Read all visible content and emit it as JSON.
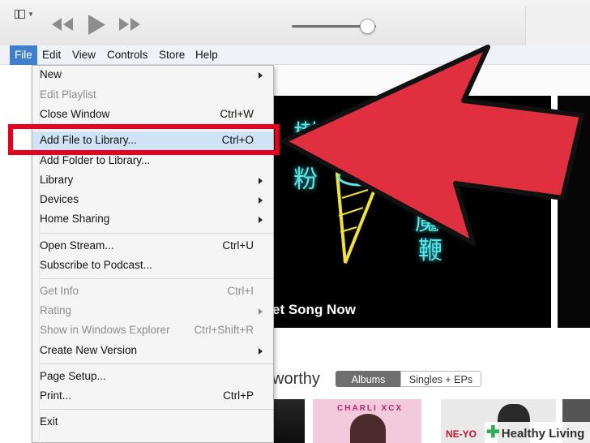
{
  "menubar": {
    "items": [
      {
        "label": "File"
      },
      {
        "label": "Edit"
      },
      {
        "label": "View"
      },
      {
        "label": "Controls"
      },
      {
        "label": "Store"
      },
      {
        "label": "Help"
      }
    ]
  },
  "player": {
    "volume_level": 0.9
  },
  "file_menu": {
    "items": [
      {
        "label": "New",
        "shortcut": "",
        "submenu": true,
        "enabled": true
      },
      {
        "label": "Edit Playlist",
        "shortcut": "",
        "submenu": false,
        "enabled": false
      },
      {
        "label": "Close Window",
        "shortcut": "Ctrl+W",
        "submenu": false,
        "enabled": true
      },
      {
        "label": "Add File to Library...",
        "shortcut": "Ctrl+O",
        "submenu": false,
        "enabled": true,
        "highlighted": true
      },
      {
        "label": "Add Folder to Library...",
        "shortcut": "",
        "submenu": false,
        "enabled": true
      },
      {
        "label": "Library",
        "shortcut": "",
        "submenu": true,
        "enabled": true
      },
      {
        "label": "Devices",
        "shortcut": "",
        "submenu": true,
        "enabled": true
      },
      {
        "label": "Home Sharing",
        "shortcut": "",
        "submenu": true,
        "enabled": true
      },
      {
        "label": "Open Stream...",
        "shortcut": "Ctrl+U",
        "submenu": false,
        "enabled": true
      },
      {
        "label": "Subscribe to Podcast...",
        "shortcut": "",
        "submenu": false,
        "enabled": true
      },
      {
        "label": "Get Info",
        "shortcut": "Ctrl+I",
        "submenu": false,
        "enabled": false
      },
      {
        "label": "Rating",
        "shortcut": "",
        "submenu": true,
        "enabled": false
      },
      {
        "label": "Show in Windows Explorer",
        "shortcut": "Ctrl+Shift+R",
        "submenu": false,
        "enabled": false
      },
      {
        "label": "Create New Version",
        "shortcut": "",
        "submenu": true,
        "enabled": true
      },
      {
        "label": "Page Setup...",
        "shortcut": "",
        "submenu": false,
        "enabled": true
      },
      {
        "label": "Print...",
        "shortcut": "Ctrl+P",
        "submenu": false,
        "enabled": true
      },
      {
        "label": "Exit",
        "shortcut": "",
        "submenu": false,
        "enabled": true
      }
    ]
  },
  "store": {
    "banner_glyphs": [
      "樹",
      "粉",
      "魔",
      "鞭"
    ],
    "banner_text": "et Song Now",
    "section_title": "worthy",
    "segments": [
      "Albums",
      "Singles + EPs"
    ],
    "thumb_texts": [
      "CHARLI XCX",
      "NE-YO"
    ]
  },
  "annotation": {
    "arrow_color": "#e0303f",
    "box_color": "#e8001f"
  },
  "watermark": {
    "text": "Healthy Living"
  }
}
